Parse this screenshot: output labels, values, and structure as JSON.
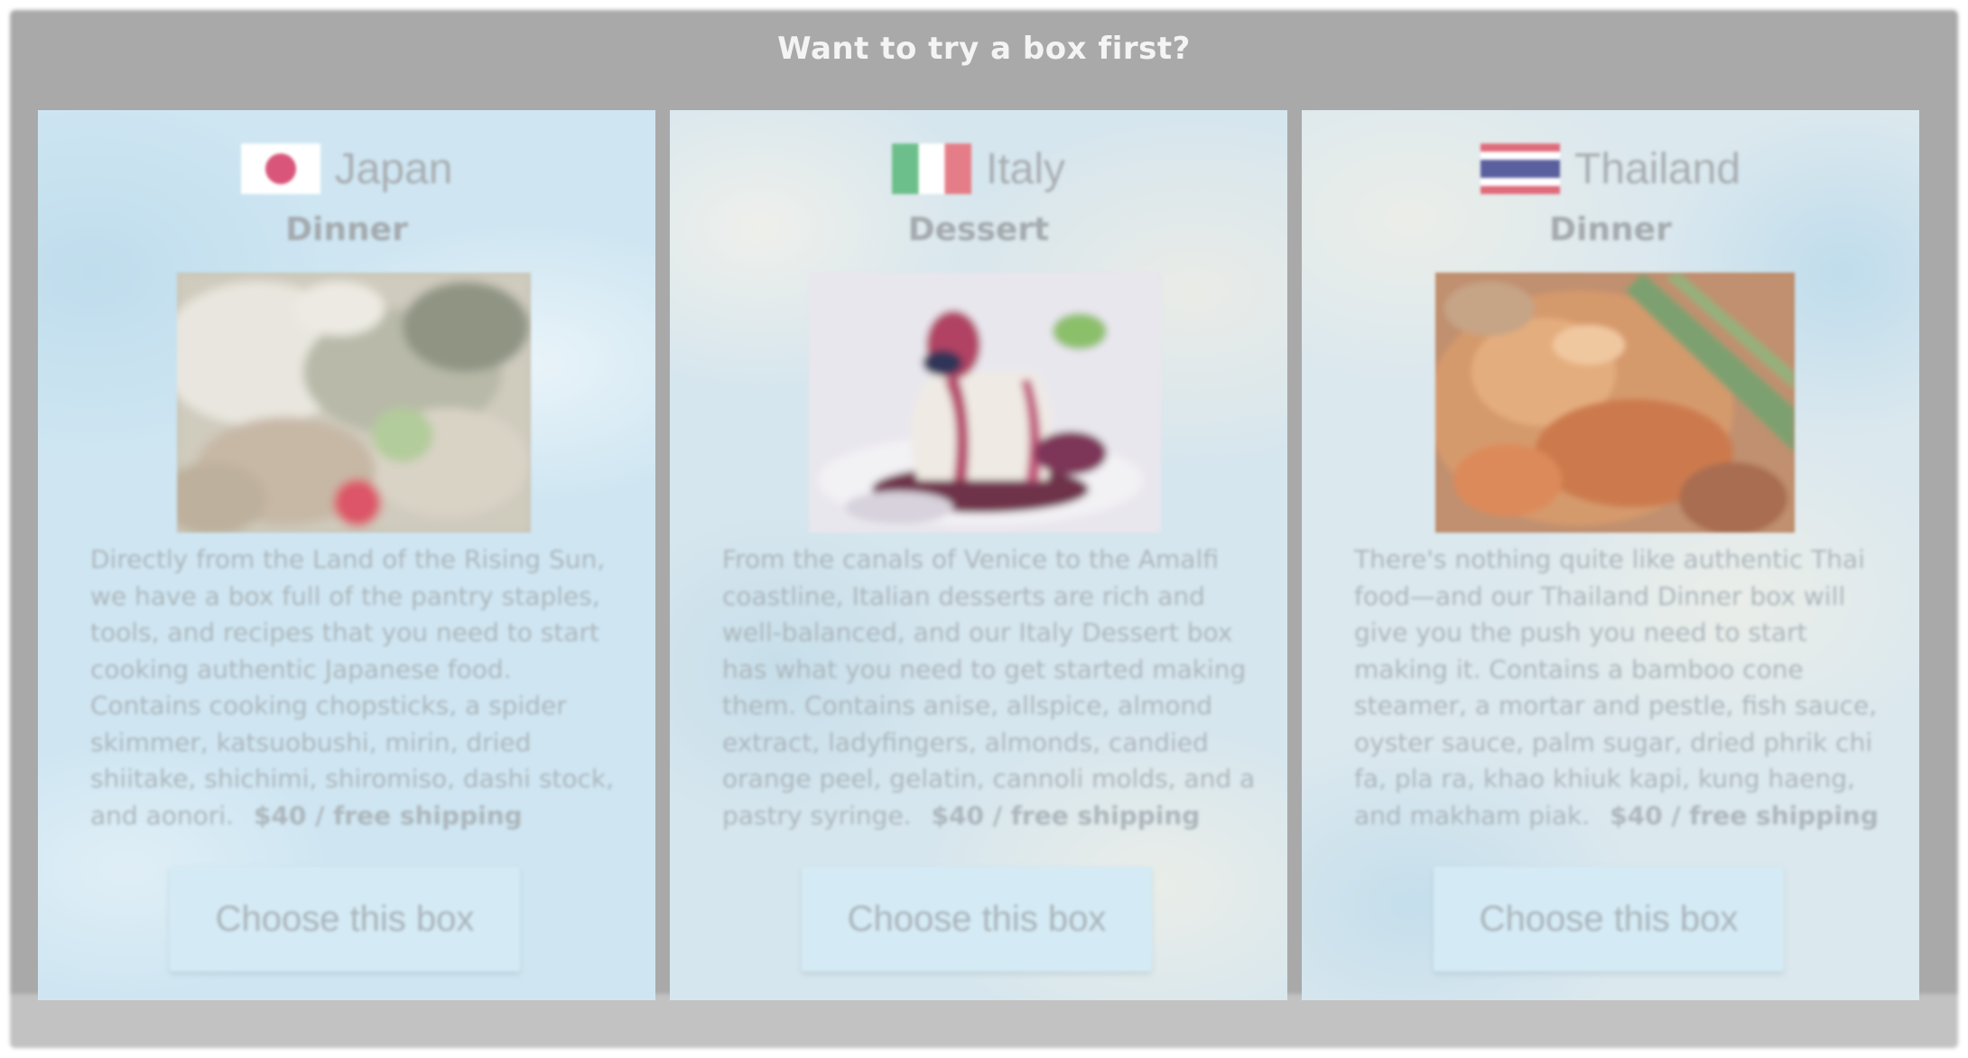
{
  "header": {
    "title": "Want to try a box first?"
  },
  "boxes": [
    {
      "country": "Japan",
      "flag_icon": "japan-flag-icon",
      "meal": "Dinner",
      "photo_icon": "japanese-dinner-photo",
      "description": "Directly from the Land of the Rising Sun, we have a box full of the pantry staples, tools, and recipes that you need to start cooking authentic Japanese food. Contains cooking chopsticks, a spider skimmer, katsuobushi, mirin, dried shiitake, shichimi, shiromiso, dashi stock, and aonori.",
      "price": "$40 / free shipping",
      "button_label": "Choose this box"
    },
    {
      "country": "Italy",
      "flag_icon": "italy-flag-icon",
      "meal": "Dessert",
      "photo_icon": "italian-dessert-photo",
      "description": "From the canals of Venice to the Amalfi coastline, Italian desserts are rich and well-balanced, and our Italy Dessert box has what you need to get started making them. Contains anise, allspice, almond extract, ladyfingers, almonds, candied orange peel, gelatin, cannoli molds, and a pastry syringe.",
      "price": "$40 / free shipping",
      "button_label": "Choose this box"
    },
    {
      "country": "Thailand",
      "flag_icon": "thailand-flag-icon",
      "meal": "Dinner",
      "photo_icon": "thai-dinner-photo",
      "description": "There's nothing quite like authentic Thai food—and our Thailand Dinner box will give you the push you need to start making it. Contains a bamboo cone steamer, a mortar and pestle, fish sauce, oyster sauce, palm sugar, dried phrik chi fa, pla ra, khao khiuk kapi, kung haeng, and makham piak.",
      "price": "$40 / free shipping",
      "button_label": "Choose this box"
    }
  ],
  "colors": {
    "frame": "#a9a9a9",
    "button_bg": "#d4eaf4",
    "text_muted": "#acb6bc"
  }
}
